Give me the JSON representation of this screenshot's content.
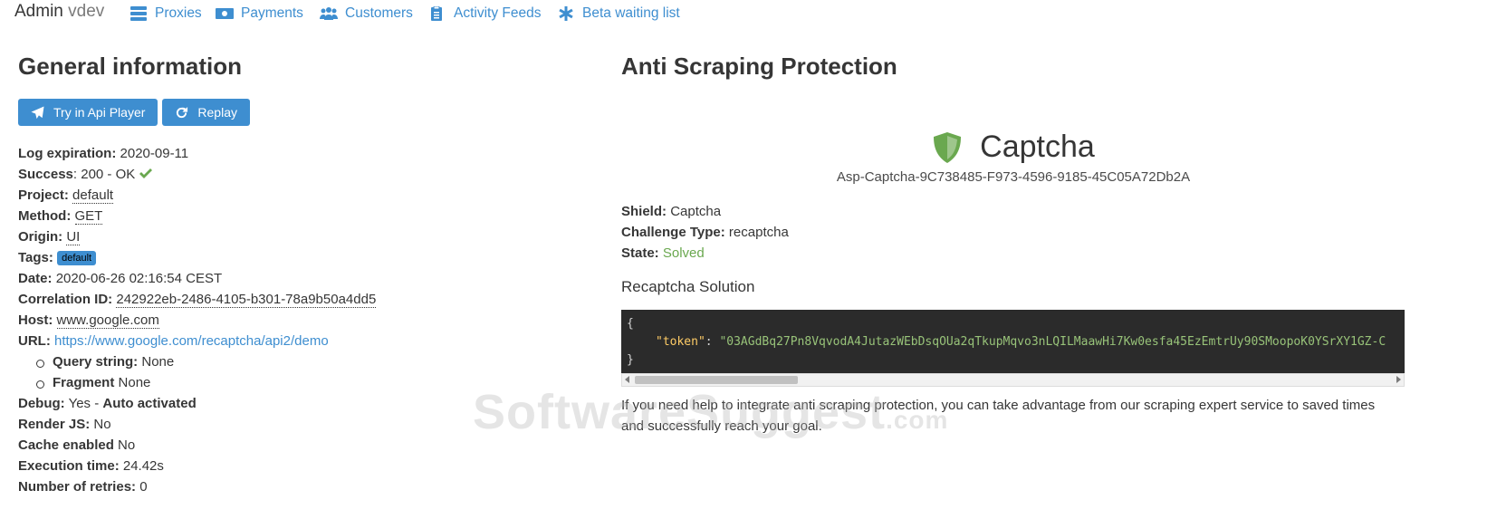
{
  "navbar": {
    "brand": "Admin",
    "env": "vdev",
    "items": [
      {
        "label": "Proxies",
        "icon": "server-icon"
      },
      {
        "label": "Payments",
        "icon": "money-icon"
      },
      {
        "label": "Customers",
        "icon": "users-icon"
      },
      {
        "label": "Activity Feeds",
        "icon": "clipboard-icon"
      },
      {
        "label": "Beta waiting list",
        "icon": "asterisk-icon"
      }
    ]
  },
  "general": {
    "title": "General information",
    "buttons": {
      "api_player": "Try in Api Player",
      "replay": "Replay"
    },
    "log_expiration_label": "Log expiration:",
    "log_expiration": "2020-09-11",
    "success_label": "Success",
    "success_value": ": 200 - OK",
    "project_label": "Project:",
    "project": "default",
    "method_label": "Method:",
    "method": "GET",
    "origin_label": "Origin:",
    "origin": "UI",
    "tags_label": "Tags:",
    "tag": "default",
    "date_label": "Date:",
    "date": "2020-06-26 02:16:54 CEST",
    "correlation_label": "Correlation ID:",
    "correlation": "242922eb-2486-4105-b301-78a9b50a4dd5",
    "host_label": "Host:",
    "host": "www.google.com",
    "url_label": "URL:",
    "url": "https://www.google.com/recaptcha/api2/demo",
    "query_label": "Query string:",
    "query": "None",
    "fragment_label": "Fragment",
    "fragment": "None",
    "debug_label": "Debug:",
    "debug": "Yes -",
    "debug_auto": "Auto activated",
    "render_label": "Render JS:",
    "render": "No",
    "cache_label": "Cache enabled",
    "cache": "No",
    "exec_label": "Execution time:",
    "exec": "24.42s",
    "retries_label": "Number of retries:",
    "retries": "0"
  },
  "anti": {
    "title": "Anti Scraping Protection",
    "captcha_title": "Captcha",
    "captcha_id": "Asp-Captcha-9C738485-F973-4596-9185-45C05A72Db2A",
    "shield_label": "Shield:",
    "shield": "Captcha",
    "challenge_label": "Challenge Type:",
    "challenge": "recaptcha",
    "state_label": "State:",
    "state": "Solved",
    "solution_title": "Recaptcha Solution",
    "code_open": "{",
    "code_key": "\"token\"",
    "code_colon": ":",
    "code_value": "\"03AGdBq27Pn8VqvodA4JutazWEbDsqOUa2qTkupMqvo3nLQILMaawHi7Kw0esfa45EzEmtrUy90SMoopoK0YSrXY1GZ-C",
    "code_close": "}",
    "help": "If you need help to integrate anti scraping protection, you can take advantage from our scraping expert service to saved times and successfully reach your goal."
  },
  "watermark": {
    "main": "SoftwareSuggest",
    "suffix": ".com"
  },
  "colors": {
    "accent": "#3e8ed0",
    "success": "#6aa84f",
    "code_bg": "#2b2b2b"
  }
}
